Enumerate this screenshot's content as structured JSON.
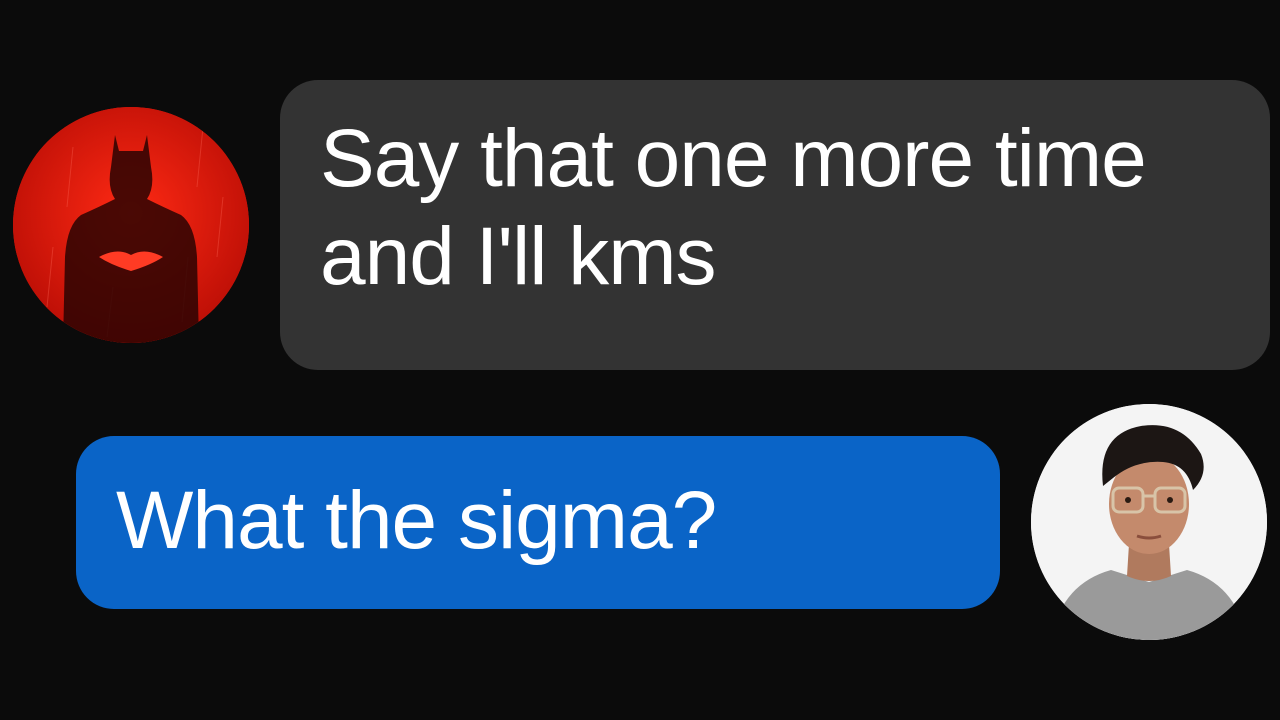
{
  "conversation": {
    "incoming": {
      "avatar_icon": "batman-silhouette-icon",
      "avatar_color": "#e3170a",
      "text": "Say that one more time and I'll kms",
      "bubble_color": "#333333"
    },
    "outgoing": {
      "avatar_icon": "person-portrait-icon",
      "text": "What the sigma?",
      "bubble_color": "#0a64c7"
    }
  },
  "background_color": "#0b0b0b"
}
